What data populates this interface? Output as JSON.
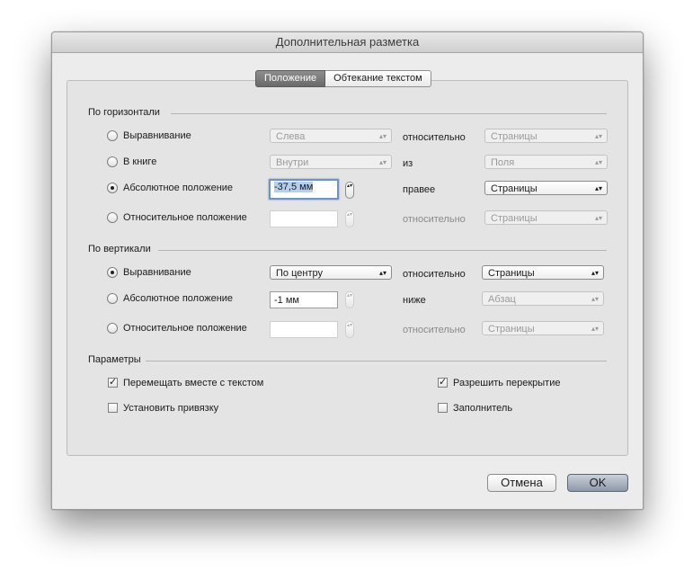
{
  "window": {
    "title": "Дополнительная разметка"
  },
  "tabs": [
    {
      "label": "Положение",
      "active": true
    },
    {
      "label": "Обтекание текстом",
      "active": false
    }
  ],
  "horizontal": {
    "title": "По горизонтали",
    "rows": [
      {
        "radio": "Выравнивание",
        "checked": false,
        "value": "Слева",
        "rel_label": "относительно",
        "rel_value": "Страницы"
      },
      {
        "radio": "В книге",
        "checked": false,
        "value": "Внутри",
        "rel_label": "из",
        "rel_value": "Поля"
      },
      {
        "radio": "Абсолютное положение",
        "checked": true,
        "value": "-37,5 мм",
        "rel_label": "правее",
        "rel_value": "Страницы"
      },
      {
        "radio": "Относительное положение",
        "checked": false,
        "value": "",
        "rel_label": "относительно",
        "rel_value": "Страницы"
      }
    ]
  },
  "vertical": {
    "title": "По вертикали",
    "rows": [
      {
        "radio": "Выравнивание",
        "checked": true,
        "value": "По центру",
        "rel_label": "относительно",
        "rel_value": "Страницы"
      },
      {
        "radio": "Абсолютное положение",
        "checked": false,
        "value": "-1 мм",
        "rel_label": "ниже",
        "rel_value": "Абзац"
      },
      {
        "radio": "Относительное положение",
        "checked": false,
        "value": "",
        "rel_label": "относительно",
        "rel_value": "Страницы"
      }
    ]
  },
  "params": {
    "title": "Параметры",
    "move_with_text": {
      "label": "Перемещать вместе с текстом",
      "checked": true
    },
    "lock_anchor": {
      "label": "Установить привязку",
      "checked": false
    },
    "allow_overlap": {
      "label": "Разрешить перекрытие",
      "checked": true
    },
    "placeholder": {
      "label": "Заполнитель",
      "checked": false
    }
  },
  "buttons": {
    "cancel": "Отмена",
    "ok": "OK"
  },
  "glyphs": {
    "updown": "▴▾",
    "check": "✓"
  }
}
